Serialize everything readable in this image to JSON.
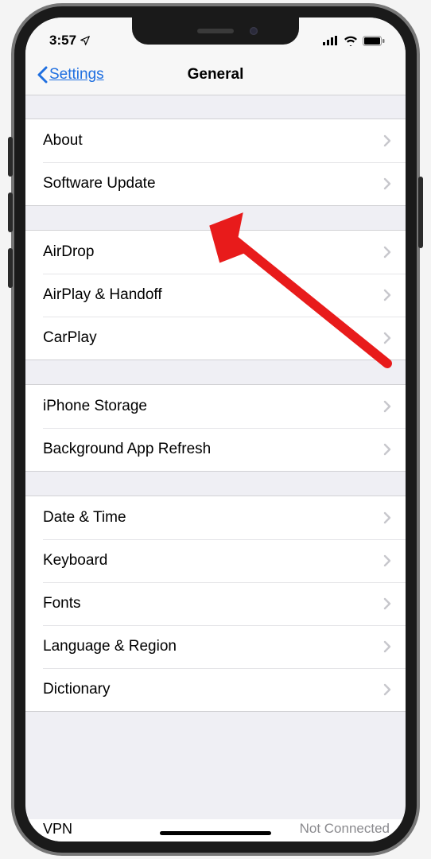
{
  "status": {
    "time": "3:57",
    "location_icon": "location-arrow",
    "signal_icon": "cellular-bars",
    "wifi_icon": "wifi",
    "battery_icon": "battery"
  },
  "nav": {
    "back_label": "Settings",
    "title": "General"
  },
  "groups": [
    {
      "items": [
        {
          "label": "About",
          "key": "about"
        },
        {
          "label": "Software Update",
          "key": "software-update"
        }
      ]
    },
    {
      "items": [
        {
          "label": "AirDrop",
          "key": "airdrop"
        },
        {
          "label": "AirPlay & Handoff",
          "key": "airplay-handoff"
        },
        {
          "label": "CarPlay",
          "key": "carplay"
        }
      ]
    },
    {
      "items": [
        {
          "label": "iPhone Storage",
          "key": "iphone-storage"
        },
        {
          "label": "Background App Refresh",
          "key": "background-app-refresh"
        }
      ]
    },
    {
      "items": [
        {
          "label": "Date & Time",
          "key": "date-time"
        },
        {
          "label": "Keyboard",
          "key": "keyboard"
        },
        {
          "label": "Fonts",
          "key": "fonts"
        },
        {
          "label": "Language & Region",
          "key": "language-region"
        },
        {
          "label": "Dictionary",
          "key": "dictionary"
        }
      ]
    }
  ],
  "partial_row": {
    "label": "VPN",
    "detail": "Not Connected"
  },
  "annotation": {
    "type": "arrow",
    "target": "software-update",
    "color": "#e81b1b"
  }
}
